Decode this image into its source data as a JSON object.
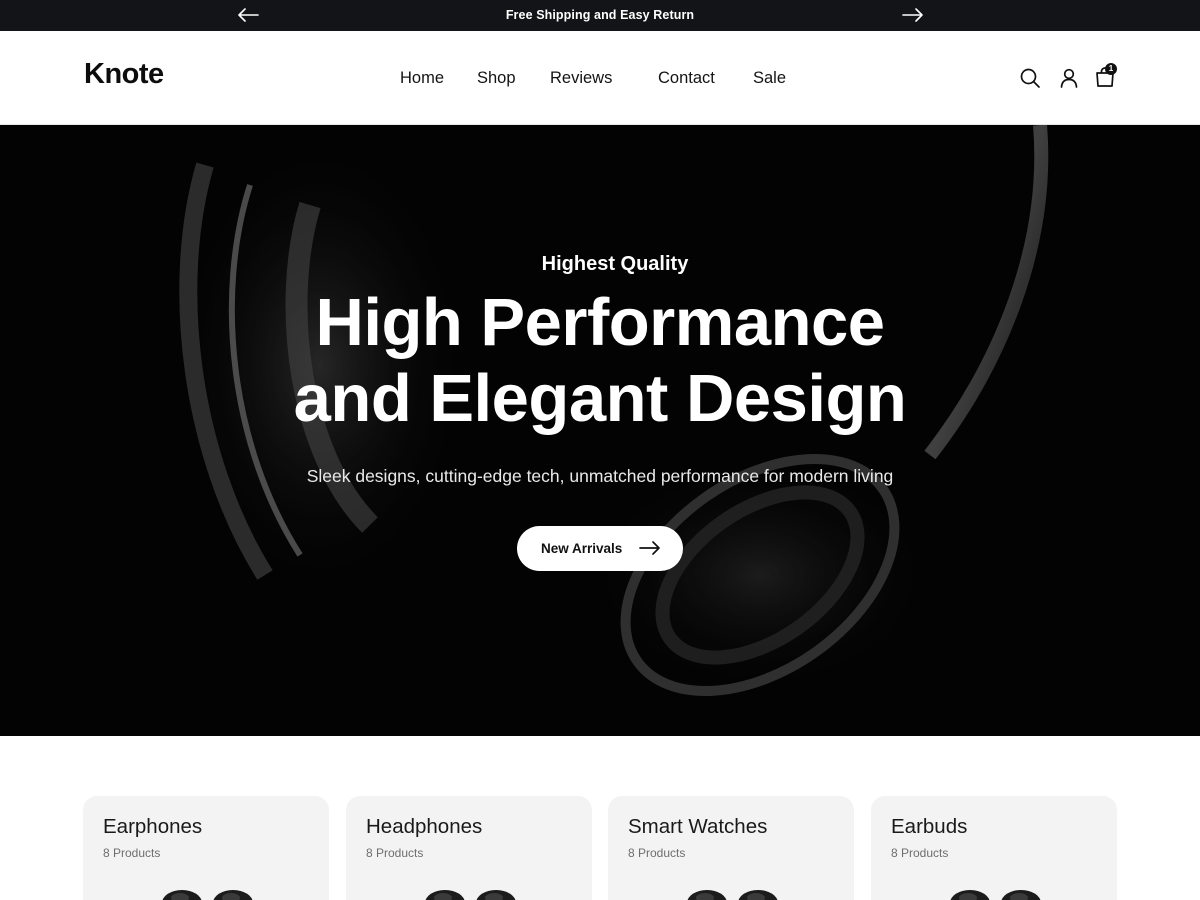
{
  "announcement": {
    "message": "Free Shipping and Easy Return",
    "prev_icon": "arrow-left-icon",
    "next_icon": "arrow-right-icon"
  },
  "header": {
    "logo": "Knote",
    "nav": [
      "Home",
      "Shop",
      "Reviews",
      "Contact",
      "Sale"
    ],
    "icons": [
      "search-icon",
      "user-icon",
      "cart-icon"
    ],
    "cart_count": "1"
  },
  "hero": {
    "eyebrow": "Highest Quality",
    "headline_line1": "High Performance",
    "headline_line2": "and Elegant Design",
    "subtitle": "Sleek designs, cutting-edge tech, unmatched performance for modern living",
    "cta_label": "New Arrivals",
    "cta_icon": "arrow-right-icon"
  },
  "categories": [
    {
      "name": "Earphones",
      "count": "8 Products"
    },
    {
      "name": "Headphones",
      "count": "8 Products"
    },
    {
      "name": "Smart Watches",
      "count": "8 Products"
    },
    {
      "name": "Earbuds",
      "count": "8 Products"
    }
  ],
  "colors": {
    "announcement_bg": "#131417",
    "hero_bg": "#050505",
    "card_bg": "#f3f3f3",
    "text_dark": "#111111"
  }
}
